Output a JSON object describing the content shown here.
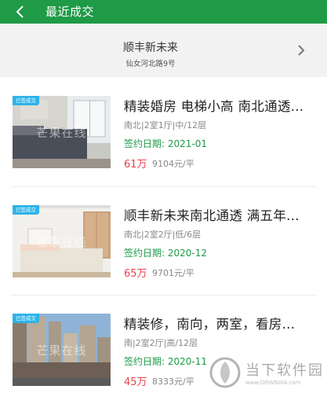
{
  "header": {
    "title": "最近成交",
    "back_icon": "chevron-left-icon"
  },
  "community": {
    "name": "顺丰新未来",
    "address": "仙女河北路9号",
    "arrow_icon": "chevron-right-icon"
  },
  "listings": [
    {
      "badge": "已签成交",
      "image_watermark": "芒果在线",
      "title": "精装婚房 电梯小高 南北通透...",
      "meta": "南北|2室1厅|中/12层",
      "sign_date": "签约日期: 2021-01",
      "price": "61万",
      "unit_price": "9104元/平"
    },
    {
      "badge": "已签成交",
      "image_watermark": "芒果在线",
      "title": "顺丰新未来南北通透  满五年...",
      "meta": "南北|2室2厅|低/6层",
      "sign_date": "签约日期: 2020-12",
      "price": "65万",
      "unit_price": "9701元/平"
    },
    {
      "badge": "已签成交",
      "image_watermark": "芒果在线",
      "title": "精装修，南向，两室，看房...",
      "meta": "南|2室2厅|高/12层",
      "sign_date": "签约日期: 2020-11",
      "price": "45万",
      "unit_price": "8333元/平"
    }
  ],
  "watermark": {
    "name": "当下软件园",
    "url": "www.DOWNXIA.com"
  },
  "colors": {
    "header_bg": "#1f9a47",
    "sign_green": "#1e9a48",
    "price_red": "#e9424b",
    "badge_blue": "#2db3e8"
  }
}
